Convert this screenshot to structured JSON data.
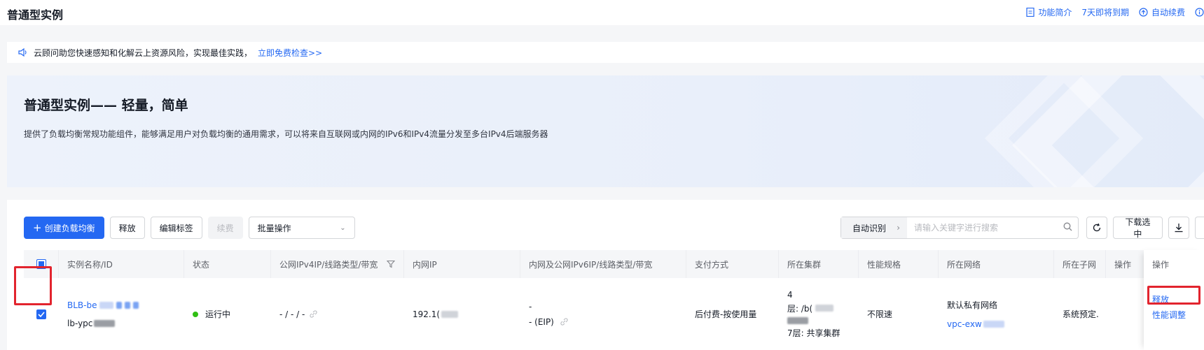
{
  "header": {
    "title": "普通型实例",
    "links": [
      {
        "label": "功能简介",
        "icon": "document-icon"
      },
      {
        "label": "7天即将到期"
      },
      {
        "label": "自动续费",
        "icon": "renew-icon"
      }
    ]
  },
  "notice": {
    "text": "云顾问助您快速感知和化解云上资源风险，实现最佳实践，",
    "action": "立即免费检查>>"
  },
  "banner": {
    "title": "普通型实例—— 轻量，简单",
    "description": "提供了负载均衡常规功能组件，能够满足用户对负载均衡的通用需求，可以将来自互联网或内网的IPv6和IPv4流量分发至多台IPv4后端服务器"
  },
  "toolbar": {
    "create": "创建负载均衡",
    "release": "释放",
    "edit_tags": "编辑标签",
    "renew": "续费",
    "batch": "批量操作"
  },
  "search": {
    "mode": "自动识别",
    "placeholder": "请输入关键字进行搜索"
  },
  "tool_right": {
    "download": "下载选中"
  },
  "table": {
    "columns": [
      "实例名称/ID",
      "状态",
      "公网IPv4IP/线路类型/带宽",
      "内网IP",
      "内网及公网IPv6IP/线路类型/带宽",
      "支付方式",
      "所在集群",
      "性能规格",
      "所在网络",
      "所在子网",
      "操作"
    ],
    "row": {
      "name": "BLB-be",
      "id": "lb-ypc",
      "status": "运行中",
      "ipv4": "- / - / -",
      "internal_ip": "192.1(",
      "ipv6_line1": "-",
      "ipv6_line2": "-  (EIP)",
      "payment": "后付费-按使用量",
      "cluster_a": "4",
      "cluster_b": "层: /b(",
      "cluster_c": "7层: 共享集群",
      "spec": "不限速",
      "network": "默认私有网络",
      "vpc": "vpc-exw",
      "subnet": "系统预定.",
      "ops": [
        "释放",
        "性能调整"
      ]
    }
  }
}
